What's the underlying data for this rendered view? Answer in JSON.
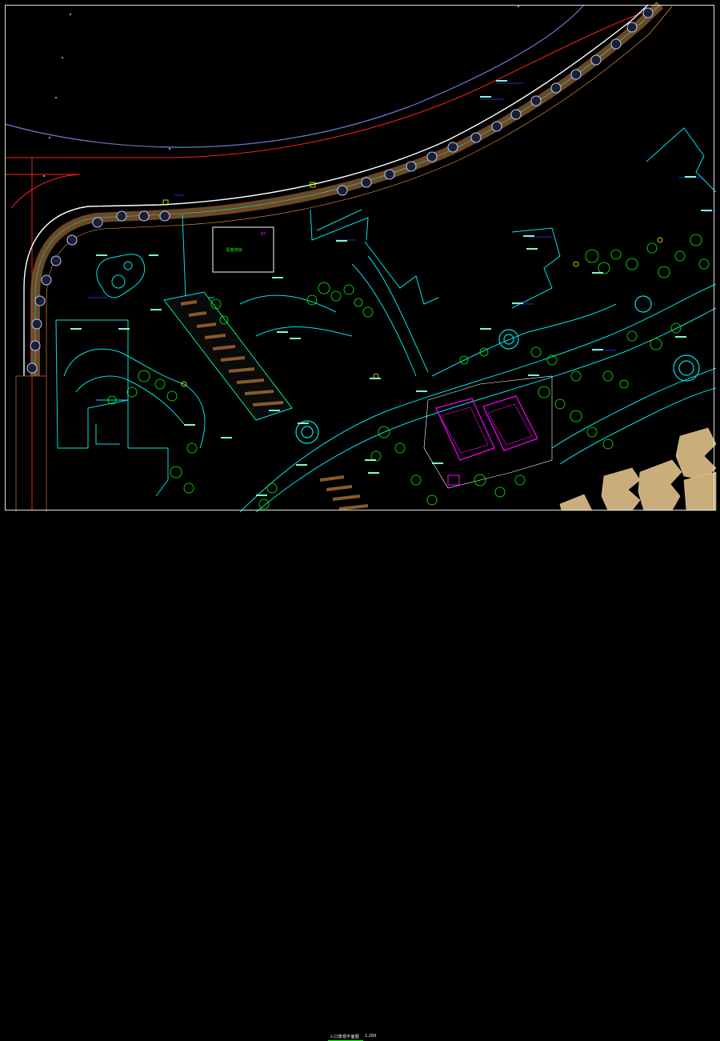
{
  "drawing": {
    "title": "入口景观平面图",
    "scale": "1:200"
  },
  "plan": {
    "building_label": "配套用房",
    "building_tag": "B7",
    "colors": {
      "background": "#000000",
      "frame": "#e0e0e0",
      "road_edge_red": "#ff2020",
      "road_edge_blue": "#6a7bd6",
      "cyan": "#00e5e5",
      "green": "#00ff00",
      "yellow": "#ffff00",
      "magenta": "#ff00ff",
      "brown": "#8a5a2a",
      "tan_buildings": "#c9ad7a",
      "blue_dims": "#2a3bff"
    }
  }
}
